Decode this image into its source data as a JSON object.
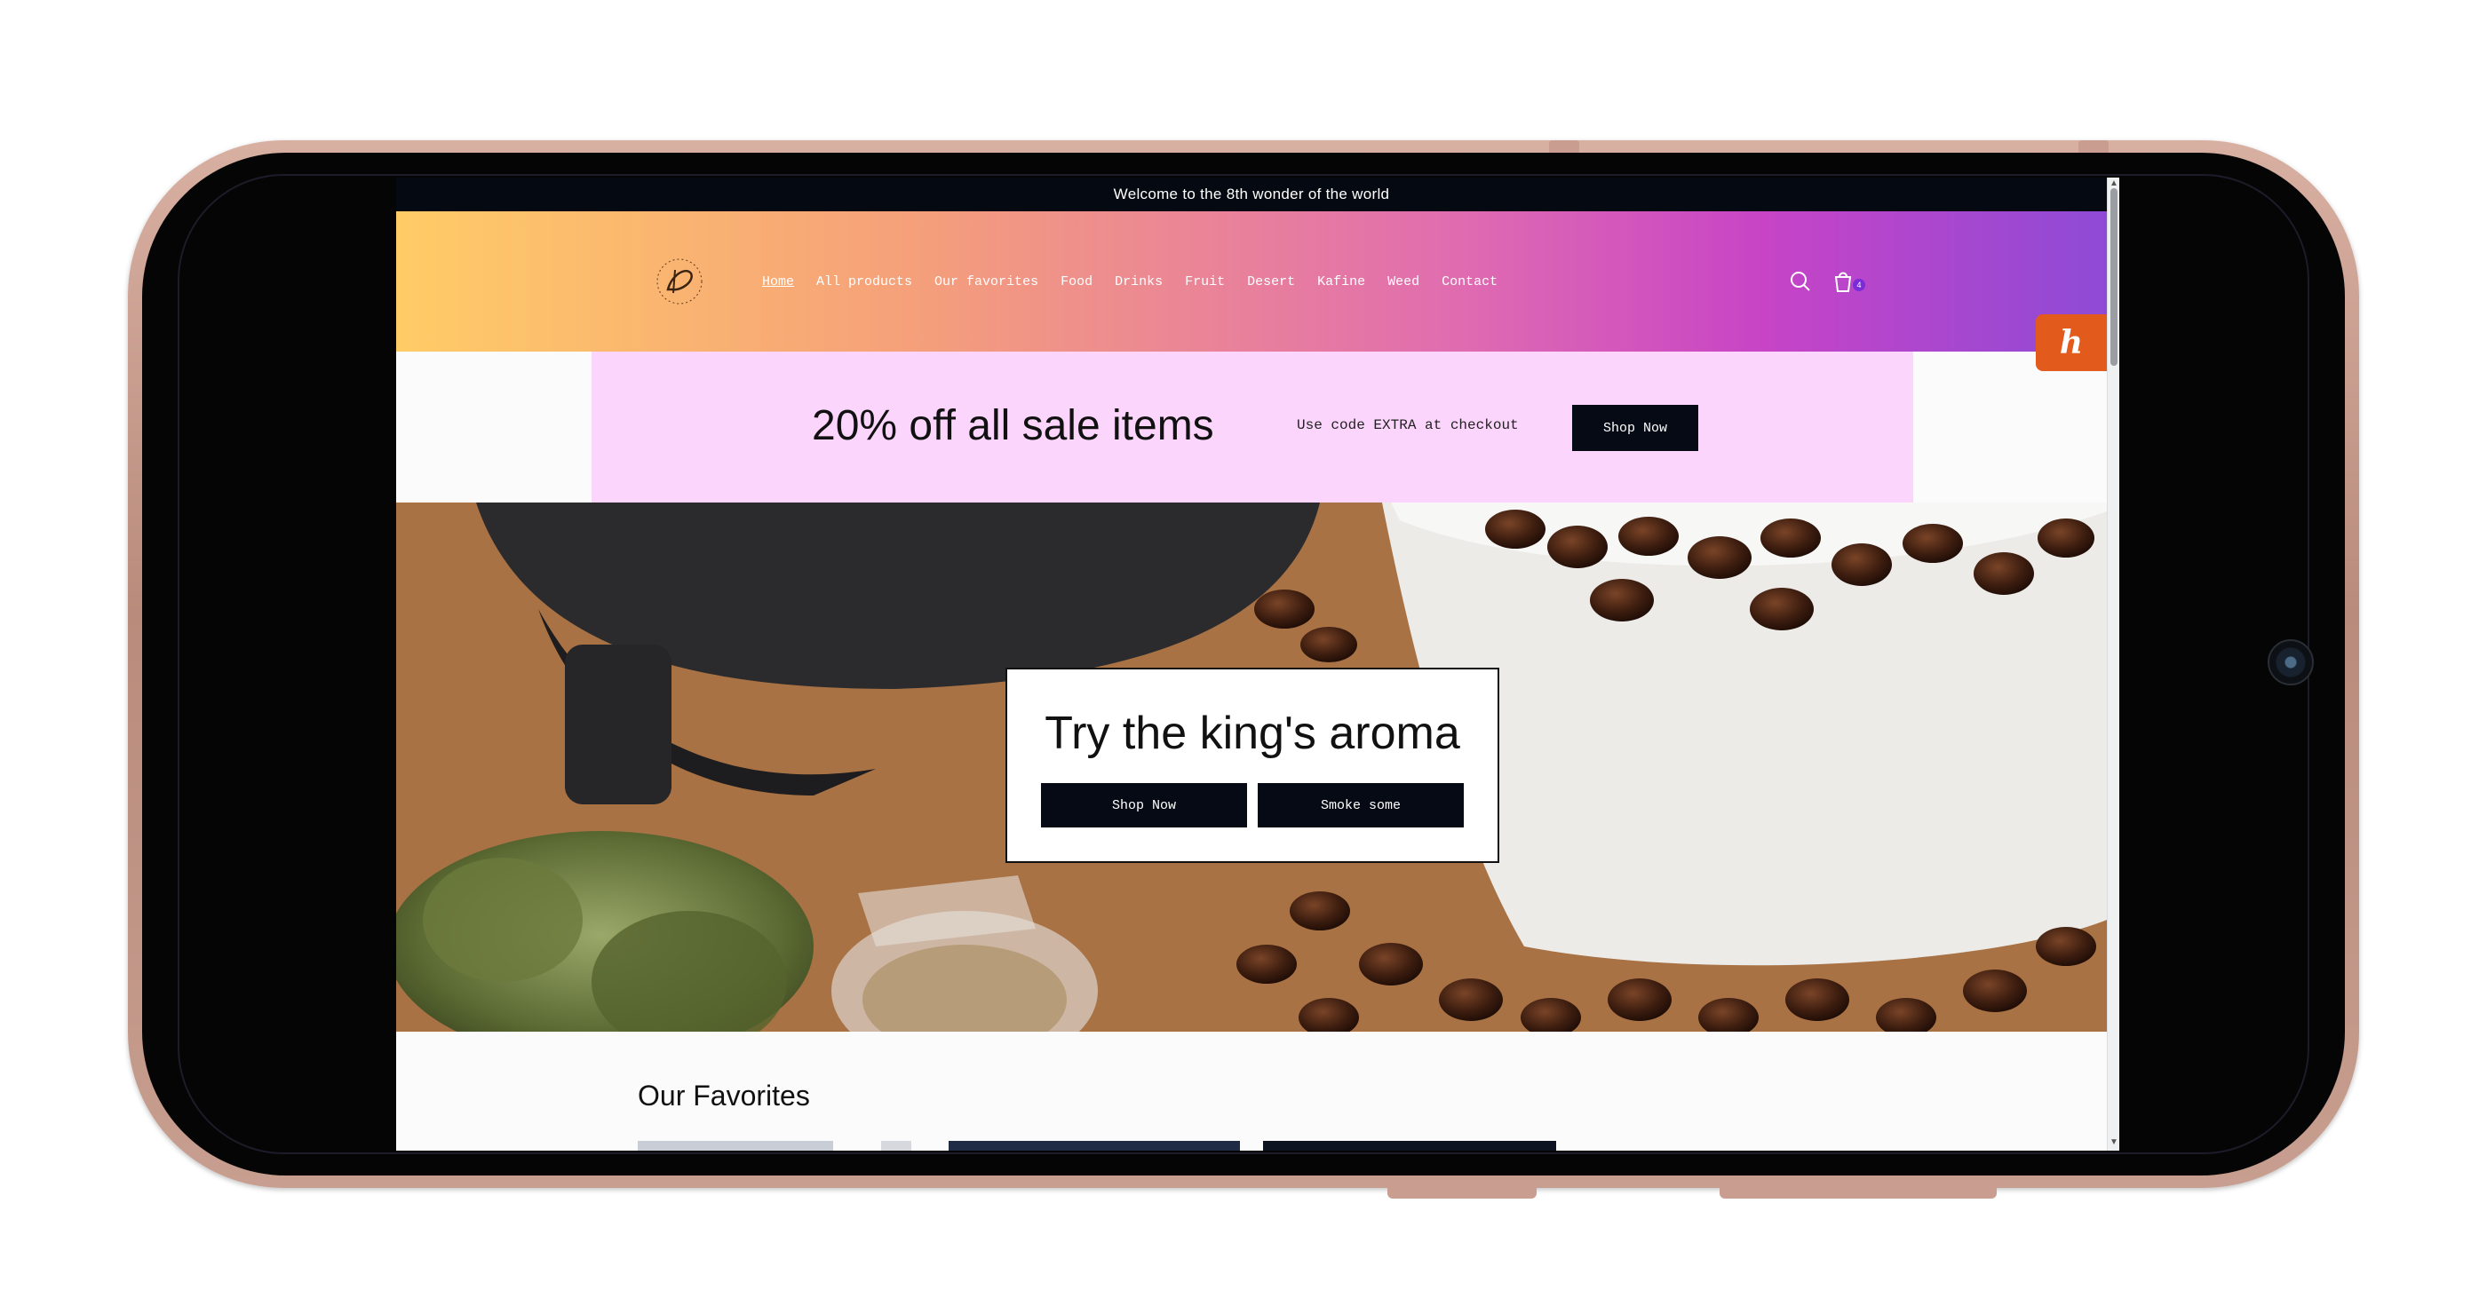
{
  "announcement": "Welcome to the 8th wonder of the world",
  "nav": [
    "Home",
    "All products",
    "Our favorites",
    "Food",
    "Drinks",
    "Fruit",
    "Desert",
    "Kafine",
    "Weed",
    "Contact"
  ],
  "header_icons": [
    "search-icon",
    "cart-icon"
  ],
  "cart_count": "4",
  "promo": {
    "headline": "20% off all sale items",
    "code_text": "Use code EXTRA at checkout",
    "button": "Shop Now"
  },
  "hero": {
    "title": "Try the king's aroma",
    "buttons": [
      "Shop Now",
      "Smoke some"
    ]
  },
  "favorites_title": "Our Favorites",
  "extension_badge": "h",
  "colors": {
    "announcement_bg": "#050a12",
    "button_bg": "#060a14",
    "promo_bg": "#fcd5fc",
    "header_gradient_start": "#ffcc66",
    "header_gradient_end": "#8e4ad6",
    "extension_orange": "#e25a1c",
    "badge_purple": "#7b2cd8"
  }
}
